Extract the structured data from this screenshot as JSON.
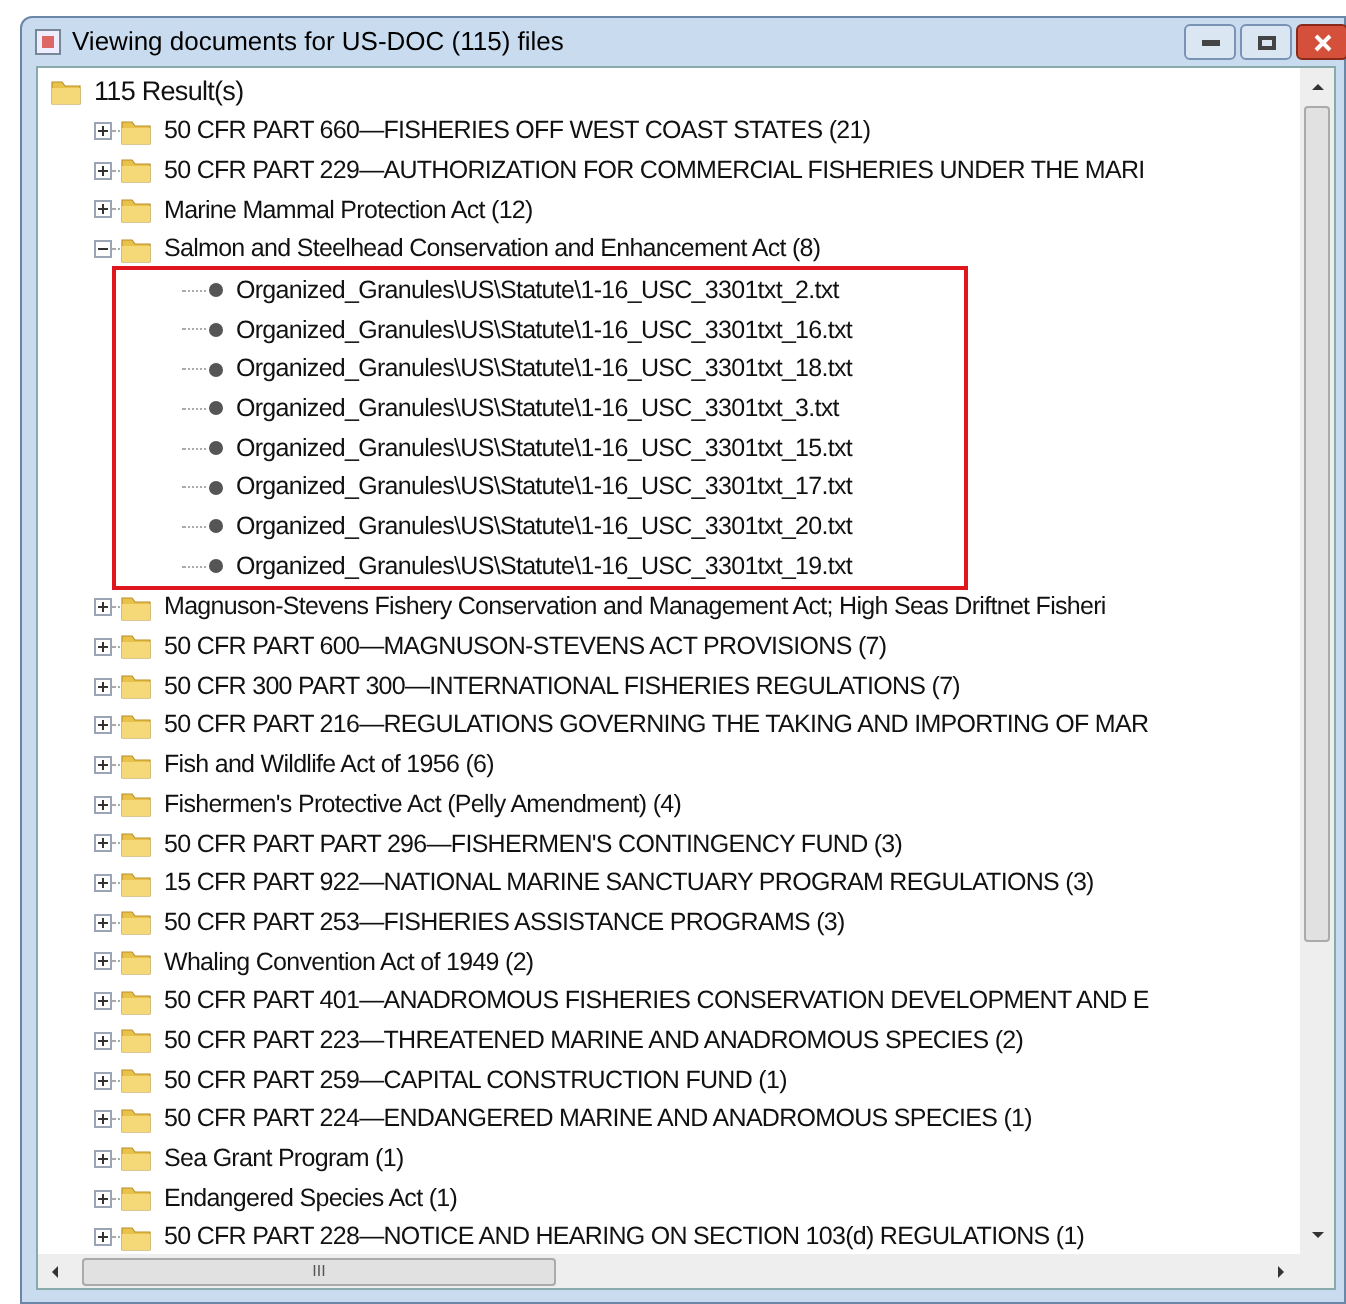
{
  "window": {
    "title": "Viewing documents for US-DOC (115) files"
  },
  "tree": {
    "label": "115 Result(s)",
    "children": [
      {
        "label": "50 CFR PART 660—FISHERIES OFF WEST COAST STATES  (21)",
        "expanded": false
      },
      {
        "label": "50 CFR PART 229—AUTHORIZATION FOR COMMERCIAL FISHERIES UNDER THE MARI",
        "expanded": false
      },
      {
        "label": "Marine Mammal Protection Act (12)",
        "expanded": false
      },
      {
        "label": "Salmon and Steelhead Conservation and Enhancement Act (8)",
        "expanded": true,
        "highlighted": true,
        "children": [
          {
            "label": "Organized_Granules\\US\\Statute\\1-16_USC_3301txt_2.txt"
          },
          {
            "label": "Organized_Granules\\US\\Statute\\1-16_USC_3301txt_16.txt"
          },
          {
            "label": "Organized_Granules\\US\\Statute\\1-16_USC_3301txt_18.txt"
          },
          {
            "label": "Organized_Granules\\US\\Statute\\1-16_USC_3301txt_3.txt"
          },
          {
            "label": "Organized_Granules\\US\\Statute\\1-16_USC_3301txt_15.txt"
          },
          {
            "label": "Organized_Granules\\US\\Statute\\1-16_USC_3301txt_17.txt"
          },
          {
            "label": "Organized_Granules\\US\\Statute\\1-16_USC_3301txt_20.txt"
          },
          {
            "label": "Organized_Granules\\US\\Statute\\1-16_USC_3301txt_19.txt"
          }
        ]
      },
      {
        "label": "Magnuson-Stevens Fishery Conservation and Management Act; High Seas Driftnet Fisheri",
        "expanded": false
      },
      {
        "label": "50 CFR PART 600—MAGNUSON-STEVENS ACT PROVISIONS  (7)",
        "expanded": false
      },
      {
        "label": "50 CFR 300 PART 300—INTERNATIONAL FISHERIES REGULATIONS  (7)",
        "expanded": false
      },
      {
        "label": "50 CFR PART 216—REGULATIONS GOVERNING THE TAKING AND IMPORTING OF MAR",
        "expanded": false
      },
      {
        "label": "Fish and Wildlife Act of 1956 (6)",
        "expanded": false
      },
      {
        "label": "Fishermen's Protective Act (Pelly Amendment) (4)",
        "expanded": false
      },
      {
        "label": "50 CFR PART PART 296—FISHERMEN'S CONTINGENCY FUND (3)",
        "expanded": false
      },
      {
        "label": "15 CFR PART 922—NATIONAL MARINE SANCTUARY PROGRAM REGULATIONS (3)",
        "expanded": false
      },
      {
        "label": "50 CFR PART 253—FISHERIES ASSISTANCE PROGRAMS  (3)",
        "expanded": false
      },
      {
        "label": "Whaling Convention Act of 1949 (2)",
        "expanded": false
      },
      {
        "label": "50 CFR PART 401—ANADROMOUS FISHERIES CONSERVATION DEVELOPMENT AND E",
        "expanded": false
      },
      {
        "label": "50 CFR PART 223—THREATENED MARINE AND ANADROMOUS SPECIES (2)",
        "expanded": false
      },
      {
        "label": "50 CFR PART 259—CAPITAL CONSTRUCTION FUND  (1)",
        "expanded": false
      },
      {
        "label": "50 CFR PART 224—ENDANGERED MARINE AND ANADROMOUS SPECIES (1)",
        "expanded": false
      },
      {
        "label": "Sea Grant Program (1)",
        "expanded": false
      },
      {
        "label": "Endangered Species Act (1)",
        "expanded": false
      },
      {
        "label": "50 CFR PART 228—NOTICE AND HEARING ON SECTION 103(d) REGULATIONS  (1)",
        "expanded": false
      }
    ]
  },
  "scrollbar_grip": "III"
}
